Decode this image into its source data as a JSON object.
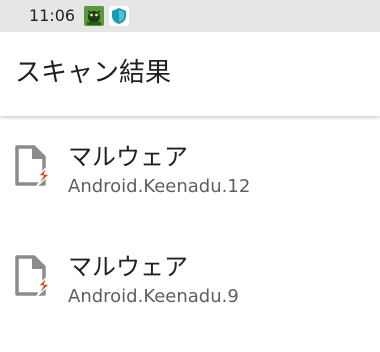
{
  "status_bar": {
    "time": "11:06",
    "icons": [
      "android-bug-icon",
      "shield-icon"
    ],
    "colors": {
      "bug_icon": "#6aa84f",
      "shield_icon": "#1a9cb0"
    }
  },
  "app_bar": {
    "title": "スキャン結果"
  },
  "results": [
    {
      "title": "マルウェア",
      "name": "Android.Keenadu.12",
      "icon": "threat-file-icon"
    },
    {
      "title": "マルウェア",
      "name": "Android.Keenadu.9",
      "icon": "threat-file-icon"
    }
  ],
  "colors": {
    "file_icon": "#8c8c8c",
    "threat_bolt": "#d84315"
  }
}
